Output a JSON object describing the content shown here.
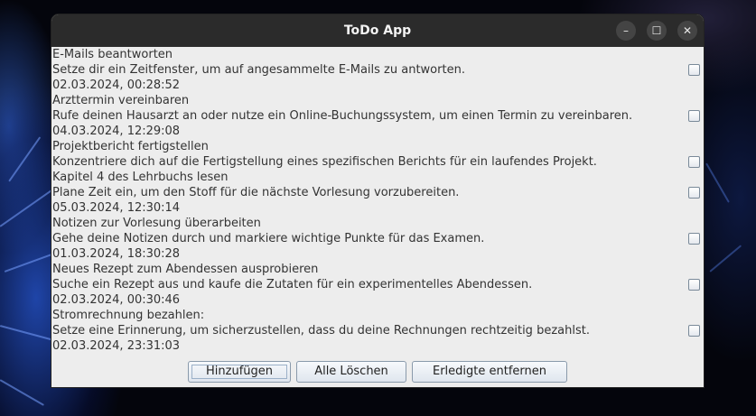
{
  "window": {
    "title": "ToDo App",
    "minimize_icon": "minimize-icon",
    "maximize_icon": "maximize-icon",
    "close_icon": "close-icon"
  },
  "tasks": [
    {
      "title": "E-Mails beantworten",
      "description": "Setze dir ein Zeitfenster, um auf angesammelte E-Mails zu antworten.",
      "date": "02.03.2024, 00:28:52",
      "done": false
    },
    {
      "title": "Arzttermin vereinbaren",
      "description": "Rufe deinen Hausarzt an oder nutze ein Online-Buchungssystem, um einen Termin zu vereinbaren.",
      "date": "04.03.2024, 12:29:08",
      "done": false
    },
    {
      "title": "Projektbericht fertigstellen",
      "description": "Konzentriere dich auf die Fertigstellung eines spezifischen Berichts für ein laufendes Projekt.",
      "date": "",
      "done": false
    },
    {
      "title": "Kapitel 4 des Lehrbuchs lesen",
      "description": "Plane Zeit ein, um den Stoff für die nächste Vorlesung vorzubereiten.",
      "date": "05.03.2024, 12:30:14",
      "done": false
    },
    {
      "title": "Notizen zur Vorlesung überarbeiten",
      "description": "Gehe deine Notizen durch und markiere wichtige Punkte für das Examen.",
      "date": "01.03.2024, 18:30:28",
      "done": false
    },
    {
      "title": "Neues Rezept zum Abendessen ausprobieren",
      "description": "Suche ein Rezept aus und kaufe die Zutaten für ein experimentelles Abendessen.",
      "date": "02.03.2024, 00:30:46",
      "done": false
    },
    {
      "title": "Stromrechnung bezahlen:",
      "description": "Setze eine Erinnerung, um sicherzustellen, dass du deine Rechnungen rechtzeitig bezahlst.",
      "date": "02.03.2024, 23:31:03",
      "done": false
    }
  ],
  "buttons": {
    "add": "Hinzufügen",
    "clear_all": "Alle Löschen",
    "remove_done": "Erledigte entfernen"
  },
  "colors": {
    "titlebar": "#2b2b2b",
    "window_bg": "#ededed",
    "text": "#333333"
  }
}
